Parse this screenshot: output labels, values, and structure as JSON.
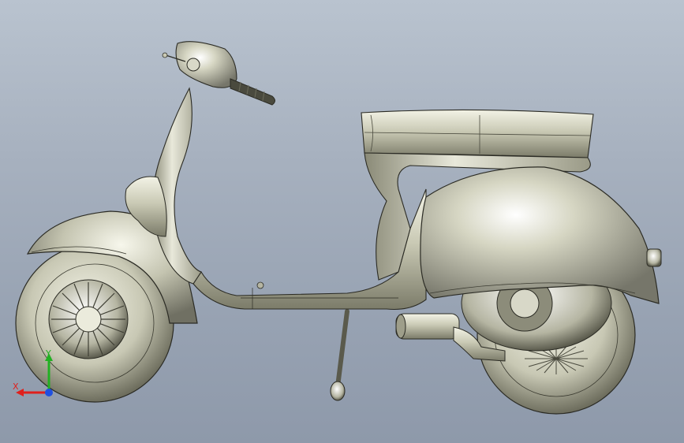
{
  "viewport": {
    "background_top": "#b9c3cf",
    "background_bottom": "#8e99aa"
  },
  "model": {
    "subject": "scooter-3d-model",
    "body_color": "#c9c9b4",
    "shadow_color": "#6f6f5e",
    "edge_color": "#2b2b24"
  },
  "triad": {
    "x_label": "X",
    "y_label": "Y",
    "x_color": "#e0201c",
    "y_color": "#22b022",
    "z_color": "#2050e0"
  }
}
